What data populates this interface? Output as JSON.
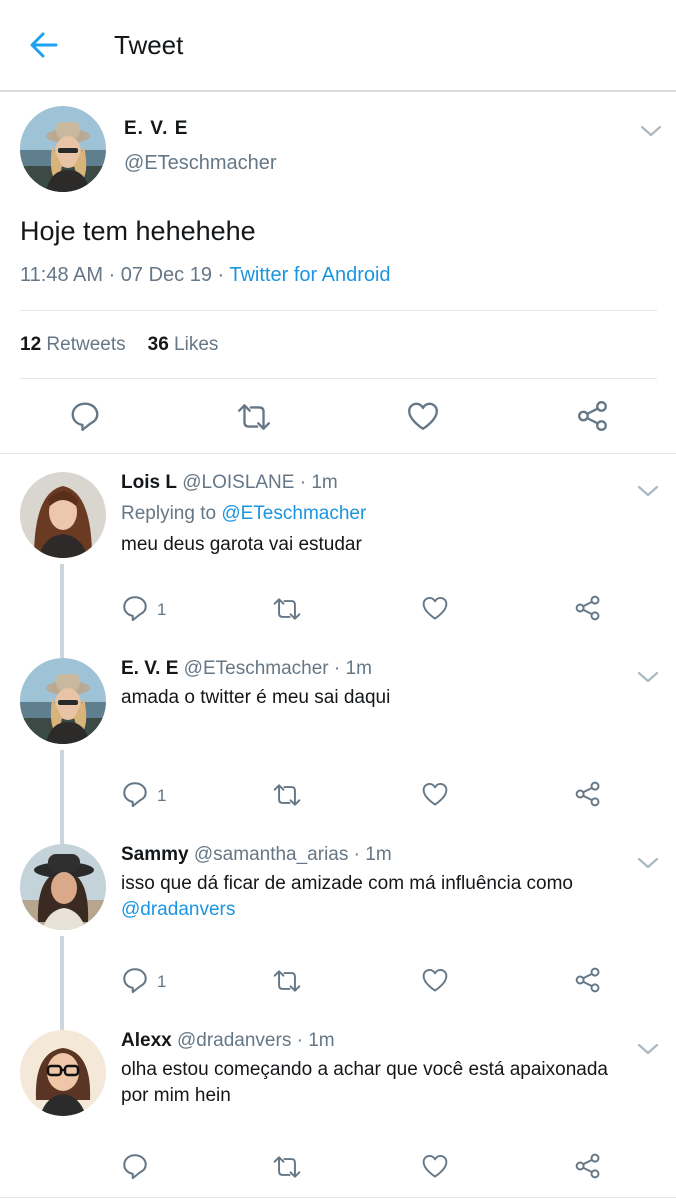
{
  "header": {
    "title": "Tweet"
  },
  "main_tweet": {
    "name": "E. V. E",
    "handle": "@ETeschmacher",
    "text": "Hoje tem hehehehe",
    "time": "11:48 AM · 07 Dec 19 · ",
    "source": "Twitter for Android",
    "retweets_count": "12",
    "retweets_label": "Retweets",
    "likes_count": "36",
    "likes_label": "Likes"
  },
  "replies": [
    {
      "name": "Lois L",
      "meta": " @LOISLANE · 1m",
      "replying_prefix": "Replying to ",
      "replying_to": "@ETeschmacher",
      "text": "meu deus garota vai estudar",
      "reply_count": "1"
    },
    {
      "name": "E. V. E",
      "meta": " @ETeschmacher · 1m",
      "text": "amada o twitter é meu sai daqui",
      "reply_count": "1"
    },
    {
      "name": "Sammy",
      "meta": " @samantha_arias · 1m",
      "text": "isso que dá ficar de amizade com má influência como",
      "mention": "@dradanvers",
      "reply_count": "1"
    },
    {
      "name": "Alexx",
      "meta": " @dradanvers · 1m",
      "text": "olha estou começando a achar que você está apaixonada",
      "text2": "por mim hein",
      "reply_count": ""
    }
  ],
  "icons": {
    "back": "arrow-left-icon",
    "caret": "chevron-down-icon",
    "reply": "reply-icon",
    "retweet": "retweet-icon",
    "like": "heart-icon",
    "share": "share-icon"
  },
  "colors": {
    "accent": "#1da1f2",
    "link": "#1b95e0",
    "secondary_text": "#657786",
    "icon": "#657786",
    "divider": "#e1e8ed"
  }
}
